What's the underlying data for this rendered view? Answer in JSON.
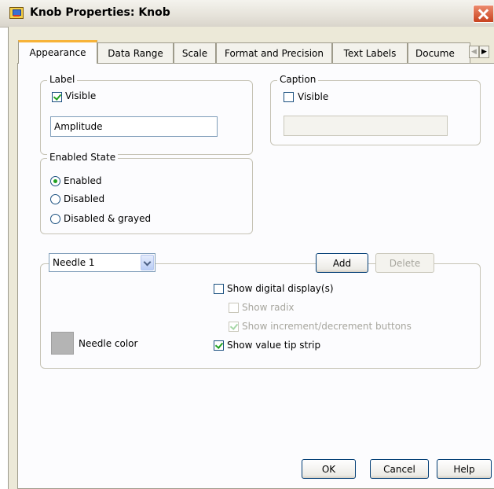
{
  "window": {
    "title": "Knob Properties: Knob"
  },
  "tabs": [
    {
      "label": "Appearance"
    },
    {
      "label": "Data Range"
    },
    {
      "label": "Scale"
    },
    {
      "label": "Format and Precision"
    },
    {
      "label": "Text Labels"
    },
    {
      "label": "Docume"
    }
  ],
  "label_group": {
    "title": "Label",
    "visible_label": "Visible",
    "visible_checked": true,
    "text_value": "Amplitude"
  },
  "caption_group": {
    "title": "Caption",
    "visible_label": "Visible",
    "visible_checked": false,
    "text_value": ""
  },
  "enabled_state": {
    "title": "Enabled State",
    "options": [
      "Enabled",
      "Disabled",
      "Disabled & grayed"
    ],
    "selected": "Enabled"
  },
  "needle": {
    "selected": "Needle 1",
    "add_label": "Add",
    "delete_label": "Delete",
    "color_label": "Needle color",
    "color": "#b4b4b4",
    "show_digital_display_label": "Show digital display(s)",
    "show_radix_label": "Show radix",
    "show_incdec_label": "Show increment/decrement buttons",
    "show_tip_strip_label": "Show value tip strip"
  },
  "buttons": {
    "ok": "OK",
    "cancel": "Cancel",
    "help": "Help"
  }
}
